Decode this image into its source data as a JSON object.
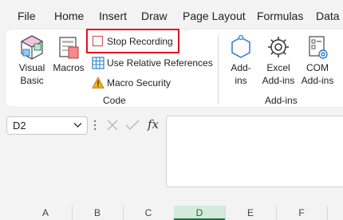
{
  "menu": [
    "File",
    "Home",
    "Insert",
    "Draw",
    "Page Layout",
    "Formulas",
    "Data"
  ],
  "ribbon": {
    "code_group": {
      "visual_basic": [
        "Visual",
        "Basic"
      ],
      "macros": "Macros",
      "stop_recording": "Stop Recording",
      "use_relative_references": "Use Relative References",
      "macro_security": "Macro Security",
      "label": "Code"
    },
    "addins_group": {
      "addins": [
        "Add-",
        "ins"
      ],
      "excel_addins": [
        "Excel",
        "Add-ins"
      ],
      "com_addins": [
        "COM",
        "Add-ins"
      ],
      "label": "Add-ins"
    }
  },
  "formula_bar": {
    "name_box": "D2",
    "fx": "fx",
    "formula": ""
  },
  "columns": [
    "A",
    "B",
    "C",
    "D",
    "E",
    "F"
  ],
  "active_column": "D",
  "colors": {
    "highlight": "#e0141e",
    "active_column": "#1e7145",
    "accent_blue": "#2b7cd3"
  }
}
